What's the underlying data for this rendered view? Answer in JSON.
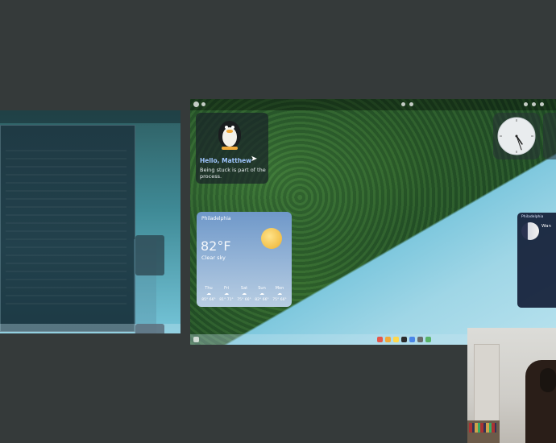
{
  "main_screen": {
    "greeting": {
      "title": "Hello, Matthew",
      "message": "Being stuck is part of the process."
    },
    "weather": {
      "location": "Philadelphia",
      "temperature": "82°F",
      "condition": "Clear sky",
      "forecast": [
        {
          "day": "Thu",
          "icon": "☁",
          "temps": "85° 66°"
        },
        {
          "day": "Fri",
          "icon": "☁",
          "temps": "81° 71°"
        },
        {
          "day": "Sat",
          "icon": "☁",
          "temps": "75° 66°"
        },
        {
          "day": "Sun",
          "icon": "☁",
          "temps": "82° 66°"
        },
        {
          "day": "Mon",
          "icon": "☁",
          "temps": "75° 66°"
        }
      ]
    },
    "clock": {
      "hour_angle_deg": 145,
      "minute_angle_deg": 160
    },
    "moon": {
      "location": "Philadelphia",
      "phase": "Wan"
    }
  },
  "colors": {
    "desktop_bg": "#353a3a",
    "greeting_title": "#9fc6ff",
    "forest": "#24502a",
    "water": "#9fd6e6"
  }
}
